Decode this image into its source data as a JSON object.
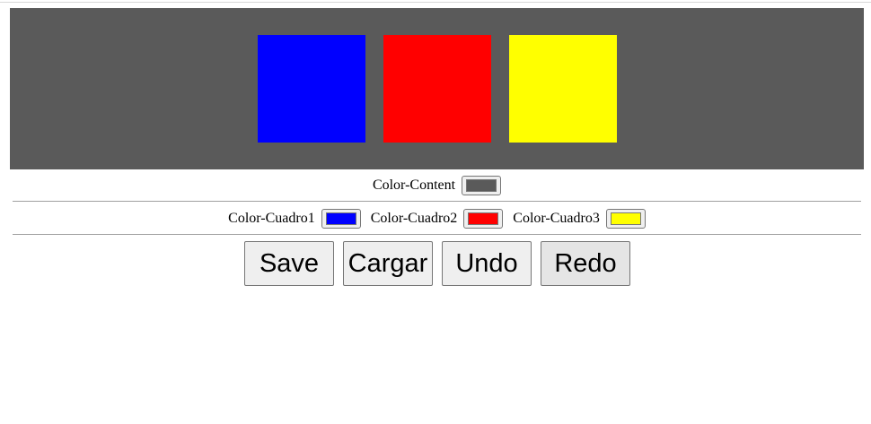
{
  "preview": {
    "content_color": "#5a5a5a",
    "squares": [
      {
        "name": "Cuadro1",
        "color": "#0000ff"
      },
      {
        "name": "Cuadro2",
        "color": "#ff0000"
      },
      {
        "name": "Cuadro3",
        "color": "#ffff00"
      }
    ]
  },
  "controls": {
    "content": {
      "label": "Color-Content",
      "value": "#5a5a5a"
    },
    "cuadros": [
      {
        "label": "Color-Cuadro1",
        "value": "#0000ff"
      },
      {
        "label": "Color-Cuadro2",
        "value": "#ff0000"
      },
      {
        "label": "Color-Cuadro3",
        "value": "#ffff00"
      }
    ]
  },
  "buttons": {
    "save": "Save",
    "cargar": "Cargar",
    "undo": "Undo",
    "redo": "Redo"
  }
}
